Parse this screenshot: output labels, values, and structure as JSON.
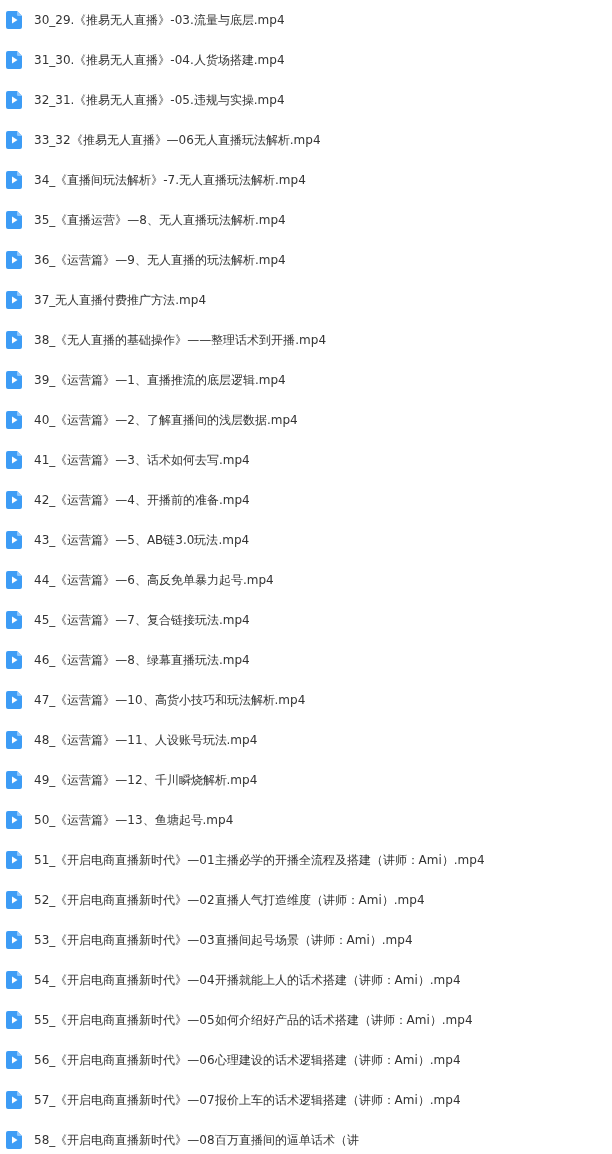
{
  "files": [
    {
      "name": "30_29.《推易无人直播》-03.流量与底层.mp4"
    },
    {
      "name": "31_30.《推易无人直播》-04.人货场搭建.mp4"
    },
    {
      "name": "32_31.《推易无人直播》-05.违规与实操.mp4"
    },
    {
      "name": "33_32《推易无人直播》—06无人直播玩法解析.mp4"
    },
    {
      "name": "34_《直播间玩法解析》-7.无人直播玩法解析.mp4"
    },
    {
      "name": "35_《直播运营》—8、无人直播玩法解析.mp4"
    },
    {
      "name": "36_《运营篇》—9、无人直播的玩法解析.mp4"
    },
    {
      "name": "37_无人直播付费推广方法.mp4"
    },
    {
      "name": "38_《无人直播的基础操作》——整理话术到开播.mp4"
    },
    {
      "name": "39_《运营篇》—1、直播推流的底层逻辑.mp4"
    },
    {
      "name": "40_《运营篇》—2、了解直播间的浅层数据.mp4"
    },
    {
      "name": "41_《运营篇》—3、话术如何去写.mp4"
    },
    {
      "name": "42_《运营篇》—4、开播前的准备.mp4"
    },
    {
      "name": "43_《运营篇》—5、AB链3.0玩法.mp4"
    },
    {
      "name": "44_《运营篇》—6、高反免单暴力起号.mp4"
    },
    {
      "name": "45_《运营篇》—7、复合链接玩法.mp4"
    },
    {
      "name": "46_《运营篇》—8、绿幕直播玩法.mp4"
    },
    {
      "name": "47_《运营篇》—10、高货小技巧和玩法解析.mp4"
    },
    {
      "name": "48_《运营篇》—11、人设账号玩法.mp4"
    },
    {
      "name": "49_《运营篇》—12、千川瞬烧解析.mp4"
    },
    {
      "name": "50_《运营篇》—13、鱼塘起号.mp4"
    },
    {
      "name": "51_《开启电商直播新时代》—01主播必学的开播全流程及搭建（讲师：Ami）.mp4"
    },
    {
      "name": "52_《开启电商直播新时代》—02直播人气打造维度（讲师：Ami）.mp4"
    },
    {
      "name": "53_《开启电商直播新时代》—03直播间起号场景（讲师：Ami）.mp4"
    },
    {
      "name": "54_《开启电商直播新时代》—04开播就能上人的话术搭建（讲师：Ami）.mp4"
    },
    {
      "name": "55_《开启电商直播新时代》—05如何介绍好产品的话术搭建（讲师：Ami）.mp4"
    },
    {
      "name": "56_《开启电商直播新时代》—06心理建设的话术逻辑搭建（讲师：Ami）.mp4"
    },
    {
      "name": "57_《开启电商直播新时代》—07报价上车的话术逻辑搭建（讲师：Ami）.mp4"
    },
    {
      "name": "58_《开启电商直播新时代》—08百万直播间的逼单话术（讲"
    }
  ]
}
